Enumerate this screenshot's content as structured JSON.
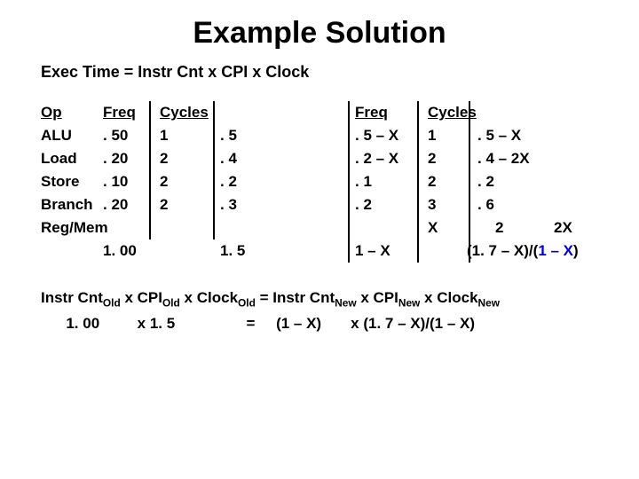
{
  "title": "Example Solution",
  "formula": "Exec Time = Instr Cnt  x CPI x Clock",
  "headers": {
    "op": "Op",
    "freq": "Freq",
    "cycles": "Cycles",
    "freq2": "Freq",
    "cycles2": "Cycles"
  },
  "rows": [
    {
      "op": "ALU",
      "f": ". 50",
      "c": "1",
      "p": ". 5",
      "f2": ". 5 – X",
      "c2": "1",
      "p2": ". 5 – X"
    },
    {
      "op": "Load",
      "f": ". 20",
      "c": "2",
      "p": ". 4",
      "f2": ". 2 – X",
      "c2": "2",
      "p2": ". 4 – 2X"
    },
    {
      "op": "Store",
      "f": ". 10",
      "c": "2",
      "p": ". 2",
      "f2": ". 1",
      "c2": "2",
      "p2": ". 2"
    },
    {
      "op": "Branch",
      "f": ". 20",
      "c": "2",
      "p": ". 3",
      "f2": ". 2",
      "c2": "3",
      "p2": ". 6"
    }
  ],
  "regmem": {
    "op": "Reg/Mem",
    "c2": "X",
    "p2": "2",
    "tail": "2X"
  },
  "totals": {
    "f": "1. 00",
    "p": "1. 5",
    "f2": "1 – X",
    "p2": "(1. 7 – X)/(",
    "p2b": "1 – X",
    "p2c": ")"
  },
  "eq": {
    "line1a": "Instr Cnt",
    "old": "Old",
    "x": " x ",
    "cpi": "CPI",
    "clk": "Clock",
    "eq": " = ",
    "new": "New",
    "l2a": "1. 00",
    "l2b": "x  1. 5",
    "l2eq": "=",
    "l2c": "(1 – X)",
    "l2d": "x  (1. 7 – X)/(1 – X)"
  }
}
